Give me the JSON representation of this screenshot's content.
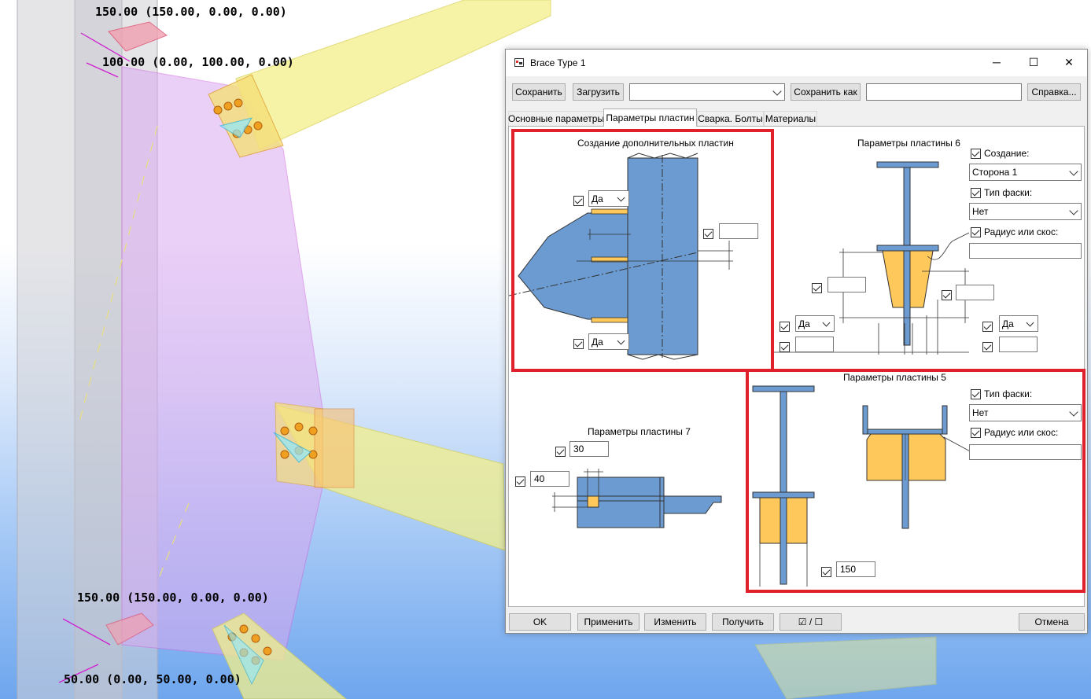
{
  "viewport": {
    "labels": [
      "150.00 (150.00, 0.00, 0.00)",
      "100.00 (0.00, 100.00, 0.00)",
      "150.00 (150.00, 0.00, 0.00)",
      "50.00 (0.00, 50.00, 0.00)"
    ]
  },
  "window": {
    "title": "Brace Type 1",
    "minimize": "─",
    "maximize": "☐",
    "close": "✕"
  },
  "toolbar": {
    "save": "Сохранить",
    "load": "Загрузить",
    "preset_value": "",
    "save_as": "Сохранить как",
    "save_as_value": "",
    "help": "Справка..."
  },
  "tabs": [
    "Основные параметры",
    "Параметры пластин",
    "Сварка. Болты",
    "Материалы"
  ],
  "active_tab": 1,
  "groups": {
    "extra_plates": {
      "title": "Создание дополнительных пластин",
      "top_yes": "Да",
      "bottom_yes": "Да",
      "side_value": ""
    },
    "plate6": {
      "title": "Параметры пластины 6",
      "create_label": "Создание:",
      "side": "Сторона 1",
      "chamfer_label": "Тип фаски:",
      "chamfer": "Нет",
      "radius_label": "Радиус или скос:",
      "radius_value": "",
      "left_value": "",
      "right_value": "",
      "left_yes": "Да",
      "right_yes": "Да",
      "left_bottom_value": "",
      "right_bottom_value": ""
    },
    "plate7": {
      "title": "Параметры пластины 7",
      "top_value": "30",
      "left_value": "40"
    },
    "plate5": {
      "title": "Параметры пластины 5",
      "chamfer_label": "Тип фаски:",
      "chamfer": "Нет",
      "radius_label": "Радиус или скос:",
      "radius_value": "",
      "bottom_value": "150"
    }
  },
  "footer": {
    "ok": "OK",
    "apply": "Применить",
    "modify": "Изменить",
    "get": "Получить",
    "toggle": "☑ / ☐",
    "cancel": "Отмена"
  },
  "colors": {
    "steel_blue": "#6b9bd1",
    "plate_yellow": "#ffc85a",
    "highlight_red": "#e0202a",
    "brace_yellow": "#f3f08a",
    "gusset_pink": "#d9a8f0"
  }
}
